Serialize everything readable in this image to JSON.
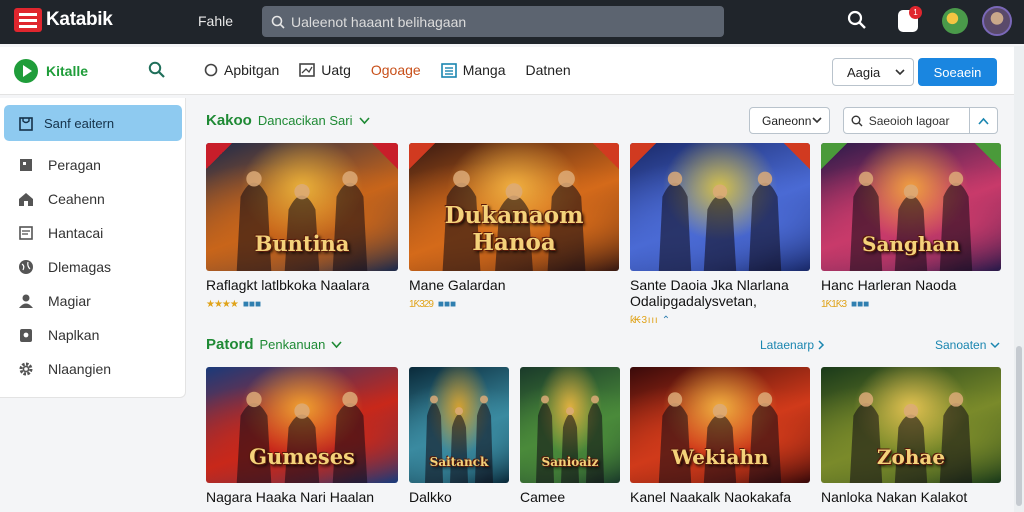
{
  "topbar": {
    "brand": "Katabik",
    "link": "Fahle",
    "search_placeholder": "Ualeenot haaant belihagaan"
  },
  "subbar": {
    "brand": "Kitalle",
    "tabs": [
      {
        "label": "Apbitgan",
        "icon": "circle-icon"
      },
      {
        "label": "Uatg",
        "icon": "image-icon"
      },
      {
        "label": "Ogoage",
        "icon": "none"
      },
      {
        "label": "Manga",
        "icon": "list-icon"
      },
      {
        "label": "Datnen",
        "icon": "none"
      }
    ],
    "active_tab": "Ogoage",
    "language_select": "Aagia",
    "primary_button": "Soeaein"
  },
  "sidebar": {
    "active_item": "Sanf eaitern",
    "items": [
      {
        "label": "Peragan",
        "icon": "grid-icon"
      },
      {
        "label": "Ceahenn",
        "icon": "home-icon"
      },
      {
        "label": "Hantacai",
        "icon": "document-icon"
      },
      {
        "label": "Dlemagas",
        "icon": "globe-icon"
      },
      {
        "label": "Magiar",
        "icon": "user-icon"
      },
      {
        "label": "Naplkan",
        "icon": "bookmark-icon"
      },
      {
        "label": "Nlaangien",
        "icon": "gear-icon"
      }
    ]
  },
  "section1": {
    "title": "Kakoo",
    "subtitle": "Dancacikan Sari",
    "filter_select": "Ganeonn",
    "filter_search_placeholder": "Saeoioh lagoar",
    "cards": [
      {
        "title": "Raflagkt latlbkoka Naalara",
        "rating": "★★★★",
        "tag": "■■■",
        "art": "Buntina",
        "palette": [
          "#1e2a4a",
          "#c8651a",
          "#e8b03a"
        ],
        "badge": "#c81e2a",
        "title_lines": [
          "Raflagkt latlbkoka Naalara"
        ]
      },
      {
        "title": "Mane Galardan",
        "rating": "1Ƙ329",
        "tag": "■■■",
        "art": "Dukanaom Hanoa",
        "palette": [
          "#3a1a12",
          "#d46a1a",
          "#f0b040"
        ],
        "badge": "#d13a20",
        "title_lines": [
          "Mane Galardan"
        ]
      },
      {
        "title": "Sante Daoia Jka Nlarlana Odalipgadalysvetan,",
        "rating": "ƙ₭ 3 ı ı ı",
        "tag": "⌃",
        "art": "",
        "palette": [
          "#1a2a6a",
          "#4a6ad4",
          "#d4c04a"
        ],
        "badge": "#d13a20",
        "title_lines": [
          "Sante Daoia Jka Nlarlana",
          "Odalipgadalysvetan,"
        ]
      },
      {
        "title": "Hanc Harleran Naoda",
        "rating": "1Ƙ1Ƙ3",
        "tag": "■■■",
        "art": "Sanghan",
        "palette": [
          "#2a1a4a",
          "#c83a6a",
          "#f0a040"
        ],
        "badge": "#4a9a3a",
        "title_lines": [
          "Hanc Harleran Naoda"
        ]
      }
    ]
  },
  "section2": {
    "title": "Patord",
    "subtitle": "Penkanuan",
    "view_all_center": "Lataenarp",
    "view_all_right": "Sanoaten",
    "cards": [
      {
        "title": "Nagara Haaka Nari Haalan",
        "art": "Gumeses",
        "palette": [
          "#1a3a7a",
          "#c8281a",
          "#f0a030"
        ],
        "title_lines": [
          "Nagara Haaka Nari Haalan"
        ]
      },
      {
        "title": "Dalkko",
        "art": "Saitanck",
        "palette": [
          "#0a2a3a",
          "#3a8aa0",
          "#d4a030"
        ],
        "title_lines": [
          "Dalkko"
        ]
      },
      {
        "title": "Camee",
        "art": "Sanioaiz",
        "palette": [
          "#1a3a2a",
          "#4a8a3a",
          "#e0b040"
        ],
        "title_lines": [
          "Camee"
        ]
      },
      {
        "title": "Kanel Naakalk Naokakafa",
        "art": "Wekiahn",
        "palette": [
          "#3a0a0a",
          "#d03a1a",
          "#f0b040"
        ],
        "title_lines": [
          "Kanel Naakalk Naokakafa"
        ]
      },
      {
        "title": "Nanloka Nakan Kalakot",
        "art": "Zohae",
        "palette": [
          "#1a3a1a",
          "#7a8a2a",
          "#e0c050"
        ],
        "title_lines": [
          "Nanloka Nakan Kalakot"
        ]
      }
    ]
  },
  "colors": {
    "topbar": "#20252b",
    "accent_green": "#1f8a35",
    "accent_blue": "#1a86e0",
    "sidebar_active": "#8ecaf0",
    "brand_red": "#e0262e"
  }
}
